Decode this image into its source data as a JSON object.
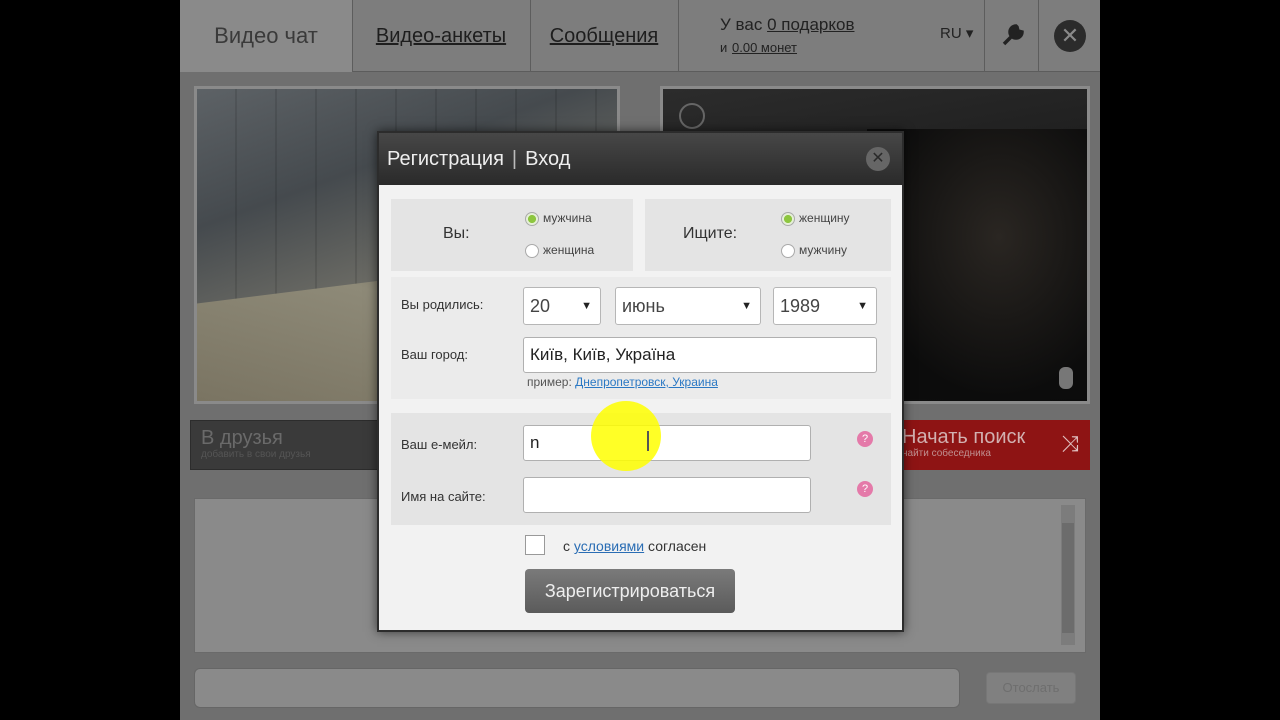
{
  "nav": {
    "active_tab": "Видео чат",
    "tab_profiles": "Видео-анкеты",
    "tab_messages": "Сообщения",
    "gifts_prefix": "У вас",
    "gifts_link": "0 подарков",
    "coins_prefix": "и",
    "coins_link": "0.00 монет",
    "lang": "RU ▾"
  },
  "buttons": {
    "friends_label": "В друзья",
    "friends_sub": "добавить в свои друзья",
    "search_label": "Начать поиск",
    "search_sub": "найти собеседника",
    "send_label": "Отослать"
  },
  "modal": {
    "title_register": "Регистрация",
    "title_sep": "|",
    "title_login": "Вход",
    "you_label": "Вы:",
    "you_opt1": "мужчина",
    "you_opt2": "женщина",
    "seek_label": "Ищите:",
    "seek_opt1": "женщину",
    "seek_opt2": "мужчину",
    "born_label": "Вы родились:",
    "day": "20",
    "month": "июнь",
    "year": "1989",
    "city_label": "Ваш город:",
    "city_value": "Київ, Київ, Україна",
    "example_prefix": "пример:",
    "example_link": "Днепропетровск, Украина",
    "email_label": "Ваш е-мейл:",
    "email_value": "n",
    "nick_label": "Имя на сайте:",
    "nick_value": "",
    "agree_prefix": "с",
    "agree_link": "условиями",
    "agree_suffix": "согласен",
    "register_button": "Зарегистрироваться"
  },
  "colors": {
    "search_button": "#8e1414",
    "radio_selected": "#8dc63f",
    "link": "#2a78c4",
    "help_icon": "#e47aa9"
  }
}
